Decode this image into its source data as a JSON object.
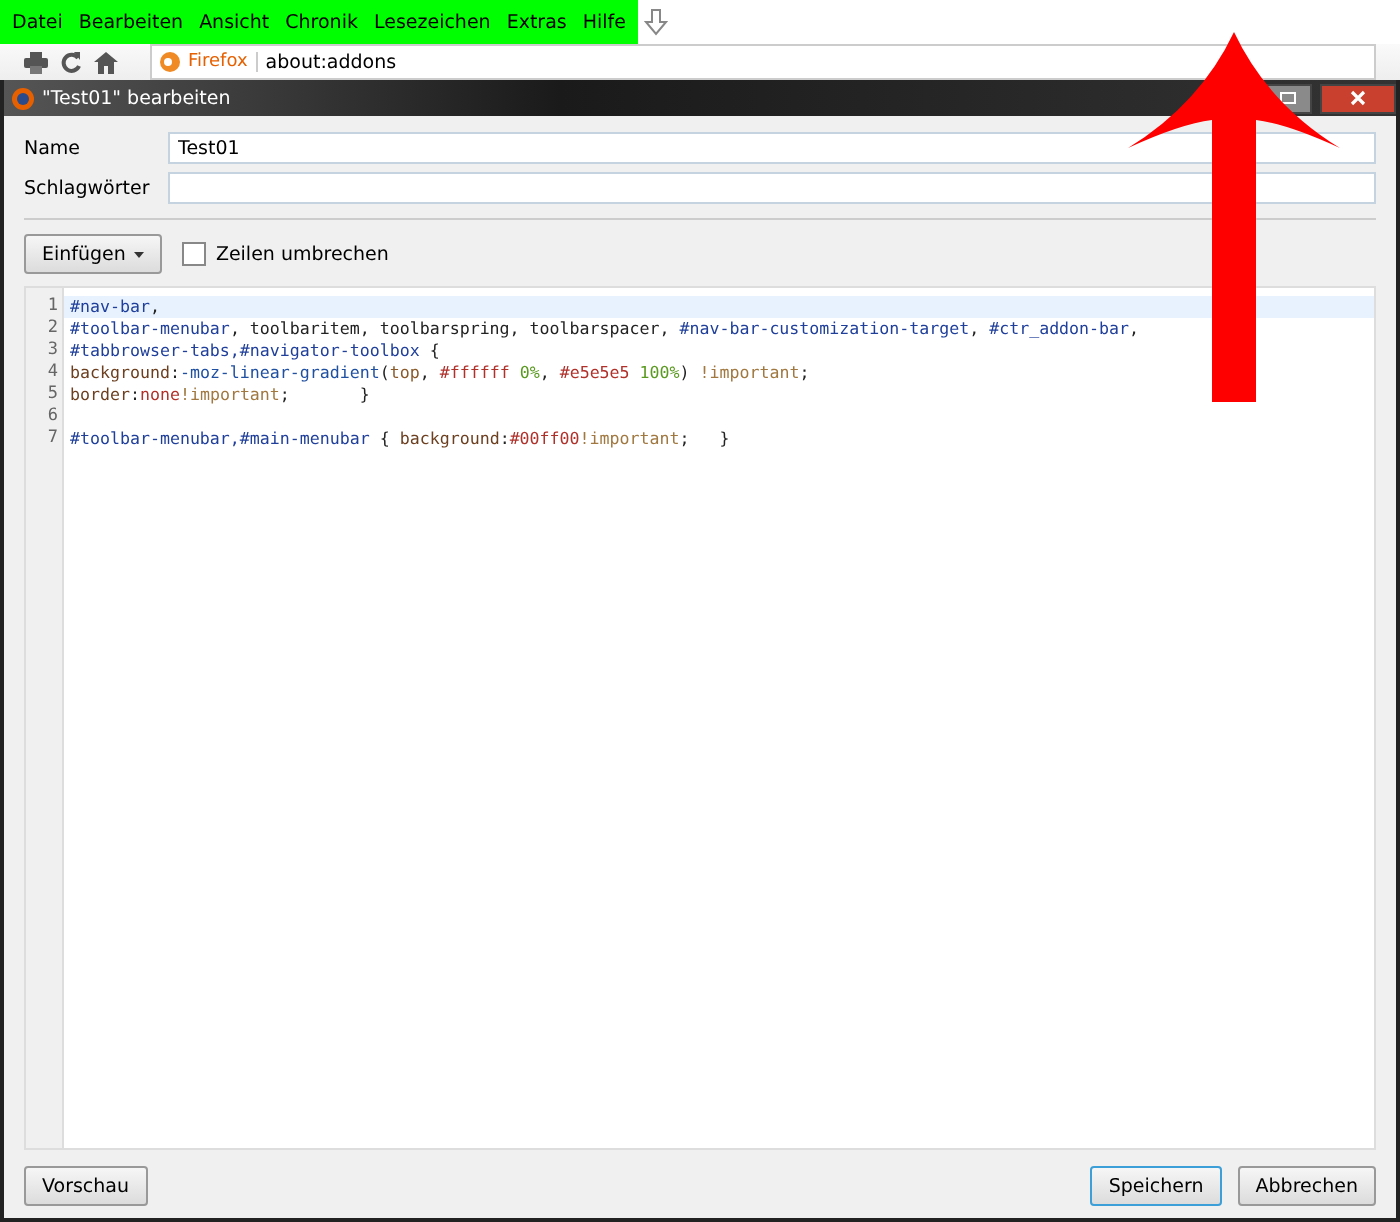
{
  "menubar": {
    "items": [
      "Datei",
      "Bearbeiten",
      "Ansicht",
      "Chronik",
      "Lesezeichen",
      "Extras",
      "Hilfe"
    ]
  },
  "navbar": {
    "identity": "Firefox",
    "url": "about:addons"
  },
  "dialog": {
    "title": "\"Test01\" bearbeiten",
    "fields": [
      {
        "label": "Name",
        "value": "Test01"
      },
      {
        "label": "Schlagwörter"
      }
    ],
    "insert_button": "Einfügen",
    "wrap_checkbox": {
      "label": "Zeilen umbrechen",
      "checked": false
    },
    "code_lines": [
      {
        "number": "1",
        "selected": true,
        "tokens": [
          {
            "kind": "selector",
            "text": "#nav-bar"
          },
          {
            "kind": "plain",
            "text": ","
          }
        ]
      },
      {
        "number": "2",
        "selected": false,
        "tokens": [
          {
            "kind": "selector",
            "text": "#toolbar-menubar"
          },
          {
            "kind": "plain",
            "text": ", toolbaritem, toolbarspring, toolbarspacer, "
          },
          {
            "kind": "selector",
            "text": "#nav-bar-customization-target"
          },
          {
            "kind": "plain",
            "text": ", "
          },
          {
            "kind": "selector",
            "text": "#ctr_addon-bar"
          },
          {
            "kind": "plain",
            "text": ","
          }
        ]
      },
      {
        "number": "3",
        "selected": false,
        "tokens": [
          {
            "kind": "selector",
            "text": "#tabbrowser-tabs,#navigator-toolbox"
          },
          {
            "kind": "plain",
            "text": " {"
          }
        ]
      },
      {
        "number": "4",
        "selected": false,
        "tokens": [
          {
            "kind": "property",
            "text": "background"
          },
          {
            "kind": "plain",
            "text": ":"
          },
          {
            "kind": "function",
            "text": "-moz-linear-gradient"
          },
          {
            "kind": "plain",
            "text": "("
          },
          {
            "kind": "keyword",
            "text": "top"
          },
          {
            "kind": "plain",
            "text": ", "
          },
          {
            "kind": "color",
            "text": "#ffffff"
          },
          {
            "kind": "number",
            "text": " 0%"
          },
          {
            "kind": "plain",
            "text": ", "
          },
          {
            "kind": "color",
            "text": "#e5e5e5"
          },
          {
            "kind": "number",
            "text": " 100%"
          },
          {
            "kind": "plain",
            "text": ") "
          },
          {
            "kind": "important",
            "text": "!important"
          },
          {
            "kind": "plain",
            "text": ";"
          }
        ]
      },
      {
        "number": "5",
        "selected": false,
        "tokens": [
          {
            "kind": "property",
            "text": "border"
          },
          {
            "kind": "plain",
            "text": ":"
          },
          {
            "kind": "color",
            "text": "none"
          },
          {
            "kind": "important",
            "text": "!important"
          },
          {
            "kind": "plain",
            "text": ";       }"
          }
        ]
      },
      {
        "number": "6",
        "selected": false
      },
      {
        "number": "7",
        "selected": false,
        "tokens": [
          {
            "kind": "selector",
            "text": "#toolbar-menubar,#main-menubar"
          },
          {
            "kind": "plain",
            "text": " { "
          },
          {
            "kind": "property",
            "text": "background"
          },
          {
            "kind": "plain",
            "text": ":"
          },
          {
            "kind": "color",
            "text": "#00ff00"
          },
          {
            "kind": "important",
            "text": "!important"
          },
          {
            "kind": "plain",
            "text": ";   }"
          }
        ]
      }
    ],
    "buttons": [
      {
        "label": "Vorschau",
        "kind": "secondary"
      },
      {
        "label": "Speichern",
        "kind": "default"
      },
      {
        "label": "Abbrechen",
        "kind": "secondary"
      }
    ]
  }
}
